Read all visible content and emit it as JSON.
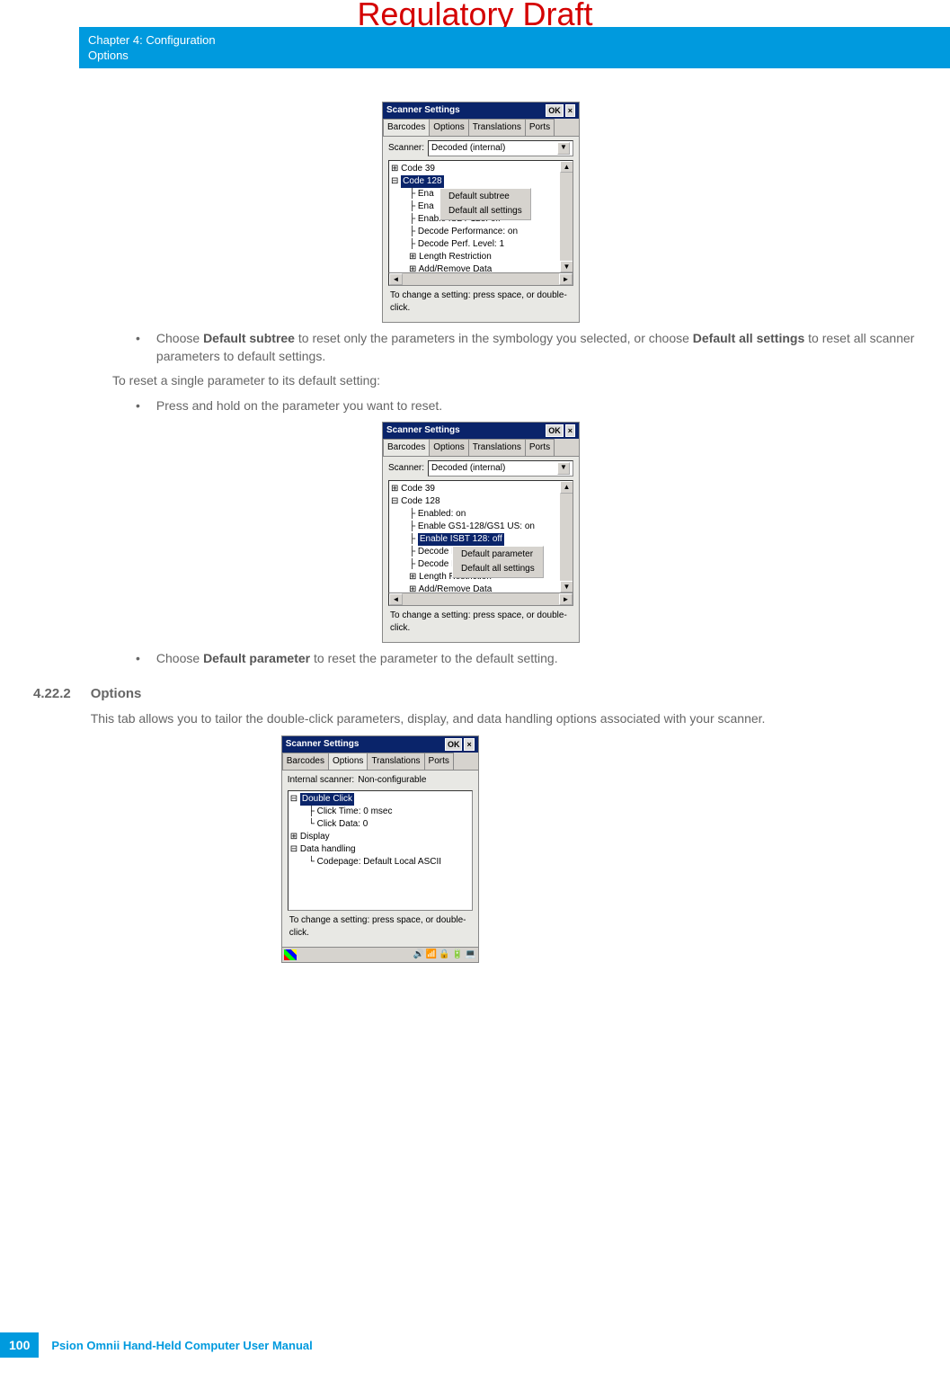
{
  "draft": "Regulatory Draft",
  "header": {
    "line1": "Chapter 4:  Configuration",
    "line2": "Options"
  },
  "shot1": {
    "title": "Scanner Settings",
    "ok": "OK",
    "close": "×",
    "tabs": [
      "Barcodes",
      "Options",
      "Translations",
      "Ports"
    ],
    "scannerLabel": "Scanner:",
    "scannerValue": "Decoded (internal)",
    "tree": {
      "n1": "Code 39",
      "n2": "Code 128",
      "n3": "Ena",
      "n4": "Ena",
      "n5": "Enable ISBT 128: off",
      "n6": "Decode Performance: on",
      "n7": "Decode Perf. Level: 1",
      "n8": "Length Restriction",
      "n9": "Add/Remove Data"
    },
    "menu": {
      "m1": "Default subtree",
      "m2": "Default all settings"
    },
    "help": "To change a setting: press space, or double-click."
  },
  "text1": {
    "pre": "Choose ",
    "b1": "Default subtree",
    "mid": " to reset only the parameters in the symbology you selected, or choose ",
    "b2": "Default all settings",
    "post": " to reset all scanner parameters to default settings."
  },
  "para1": "To reset a single parameter to its default setting:",
  "text2": "Press and hold on the parameter you want to reset.",
  "shot2": {
    "title": "Scanner Settings",
    "ok": "OK",
    "close": "×",
    "tabs": [
      "Barcodes",
      "Options",
      "Translations",
      "Ports"
    ],
    "scannerLabel": "Scanner:",
    "scannerValue": "Decoded (internal)",
    "tree": {
      "n1": "Code 39",
      "n2": "Code 128",
      "n3": "Enabled: on",
      "n4": "Enable GS1-128/GS1 US: on",
      "n5": "Enable ISBT 128: off",
      "n6": "Decode P",
      "n7": "Decode P",
      "n8": "Length Restriction",
      "n9": "Add/Remove Data"
    },
    "menu": {
      "m1": "Default parameter",
      "m2": "Default all settings"
    },
    "help": "To change a setting: press space, or double-click."
  },
  "text3": {
    "pre": "Choose ",
    "b1": "Default parameter",
    "post": " to reset the parameter to the default setting."
  },
  "section": {
    "num": "4.22.2",
    "title": "Options",
    "body": "This tab allows you to tailor the double-click parameters, display, and data handling options associated with your scanner."
  },
  "shot3": {
    "title": "Scanner Settings",
    "ok": "OK",
    "close": "×",
    "tabs": [
      "Barcodes",
      "Options",
      "Translations",
      "Ports"
    ],
    "row": {
      "label": "Internal scanner:",
      "value": "Non-configurable"
    },
    "tree": {
      "n1": "Double Click",
      "n2": "Click Time: 0 msec",
      "n3": "Click Data: 0",
      "n4": "Display",
      "n5": "Data handling",
      "n6": "Codepage: Default Local ASCII"
    },
    "help": "To change a setting: press space, or double-click."
  },
  "footer": {
    "page": "100",
    "text": "Psion Omnii Hand-Held Computer User Manual"
  }
}
